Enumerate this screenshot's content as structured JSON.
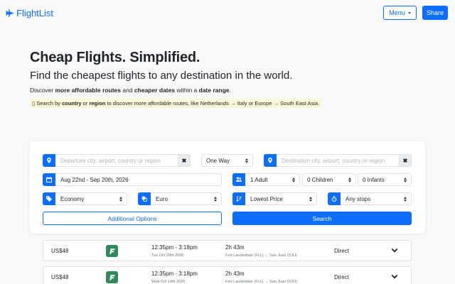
{
  "header": {
    "brand": "FlightList",
    "menu_label": "Menu",
    "share_label": "Share"
  },
  "hero": {
    "title": "Cheap Flights. Simplified.",
    "subtitle": "Find the cheapest flights to any destination in the world.",
    "desc_pre": "Discover ",
    "desc_b1": "more affordable routes",
    "desc_mid": " and ",
    "desc_b2": "cheaper dates",
    "desc_mid2": " within a ",
    "desc_b3": "date range",
    "desc_end": ".",
    "tip_icon": "▯",
    "tip_pre": " Search by ",
    "tip_b1": "country",
    "tip_mid": " or ",
    "tip_b2": "region",
    "tip_end": " to discover more affordable routes, like Netherlands → Italy or Europe → South East Asia."
  },
  "search": {
    "departure_placeholder": "Departure city, airport, country or region",
    "trip_type": "One Way",
    "destination_placeholder": "Destination city, airport, country or region",
    "date_range": "Aug 22nd - Sep 20th, 2026",
    "adults": "1 Adult",
    "children": "0 Children",
    "infants": "0 Infants",
    "cabin": "Economy",
    "currency": "Euro",
    "sort": "Lowest Price",
    "stops": "Any stops",
    "additional_options_label": "Additional Options",
    "search_label": "Search",
    "clear_glyph": "✖"
  },
  "results": [
    {
      "price": "US$48",
      "time": "12:35pm - 3:18pm",
      "date": "Tue Oct 20th 2026",
      "duration": "2h 43m",
      "route": "Fort Lauderdale (FLL) → San Juan (SJU)",
      "stops": "Direct"
    },
    {
      "price": "US$48",
      "time": "12:35pm - 3:18pm",
      "date": "Wed Oct 14th 2026",
      "duration": "2h 43m",
      "route": "Fort Lauderdale (FLL) → San Juan (SJU)",
      "stops": "Direct"
    }
  ],
  "icons": {
    "brand": "airplane-icon",
    "departure": "map-pin-icon",
    "destination": "map-pin-icon",
    "calendar": "calendar-icon",
    "passengers": "users-icon",
    "cabin": "tag-icon",
    "currency": "coins-icon",
    "sort": "sort-icon",
    "stops": "stopwatch-icon",
    "expand": "chevron-down-icon"
  },
  "colors": {
    "accent": "#0d6efd",
    "airline_logo": "#2e8b57",
    "tip_highlight": "#fdf6d6"
  }
}
